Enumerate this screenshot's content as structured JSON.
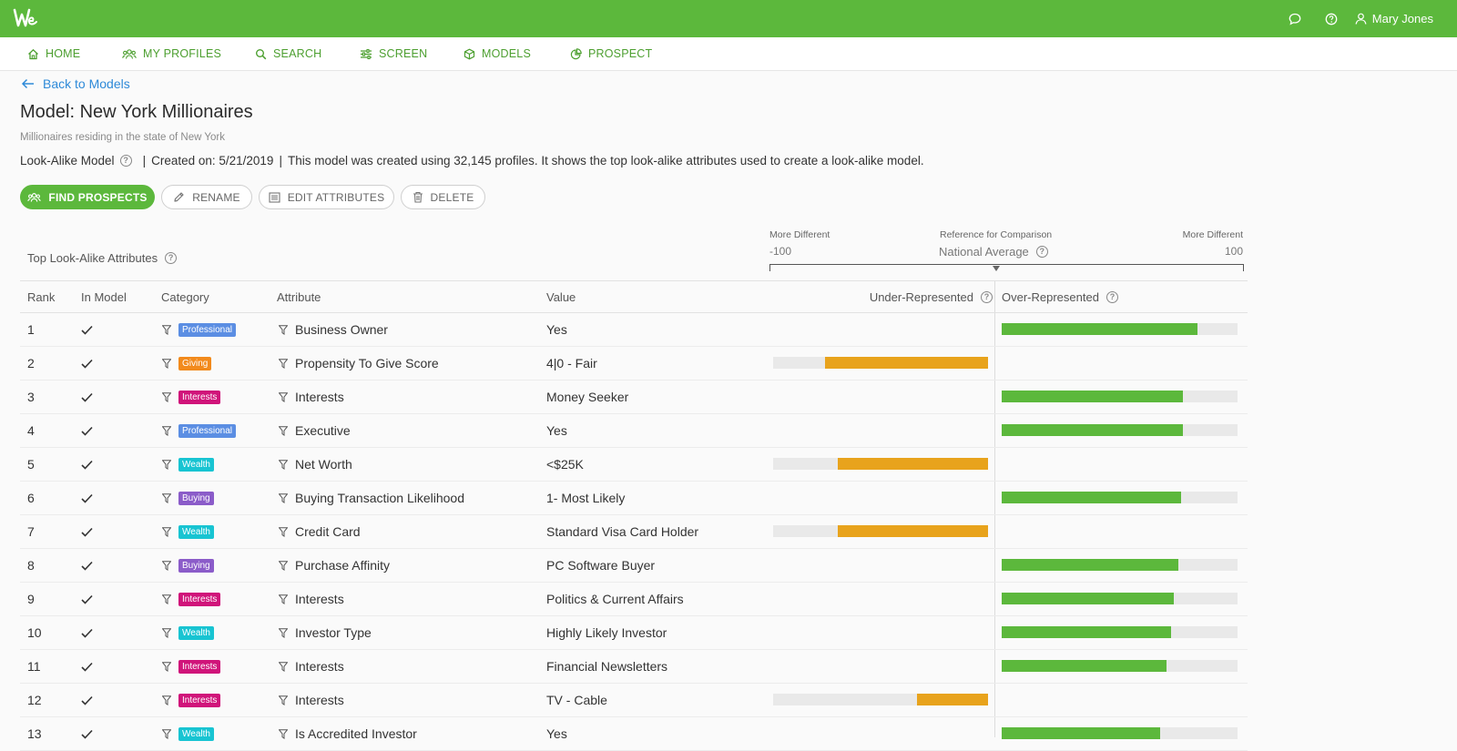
{
  "colors": {
    "brand": "#5cb83c",
    "link": "#2e8ad8",
    "over": "#5cb83c",
    "under": "#e8a31c",
    "badges": {
      "Professional": "#5b8ee3",
      "Giving": "#f28a1c",
      "Interests": "#d0147a",
      "Wealth": "#18c4d2",
      "Buying": "#8b5cc9"
    }
  },
  "header": {
    "logo_icon": "we-logo-icon",
    "chat_icon": "chat-bubble-icon",
    "help_icon": "help-circle-icon",
    "user_icon": "user-icon",
    "user_name": "Mary Jones"
  },
  "nav": {
    "items": [
      {
        "label": "HOME",
        "icon": "home-icon"
      },
      {
        "label": "MY PROFILES",
        "icon": "people-icon"
      },
      {
        "label": "SEARCH",
        "icon": "search-icon"
      },
      {
        "label": "SCREEN",
        "icon": "sliders-icon"
      },
      {
        "label": "MODELS",
        "icon": "cube-icon"
      },
      {
        "label": "PROSPECT",
        "icon": "pie-chart-icon"
      }
    ]
  },
  "page": {
    "back_label": "Back to Models",
    "title": "Model: New York Millionaires",
    "subtitle": "Millionaires residing in the state of New York",
    "model_type": "Look-Alike Model",
    "separator": "|",
    "created": "Created on: 5/21/2019",
    "description": "This model was created using 32,145 profiles. It shows the top look-alike attributes used to create a look-alike model."
  },
  "actions": {
    "find_prospects": "FIND PROSPECTS",
    "rename": "RENAME",
    "edit_attributes": "EDIT ATTRIBUTES",
    "delete": "DELETE"
  },
  "scale": {
    "left_caption": "More Different",
    "left_value": "-100",
    "center_caption": "Reference for Comparison",
    "center_value": "National Average",
    "right_caption": "More Different",
    "right_value": "100"
  },
  "table": {
    "section_label": "Top Look-Alike Attributes",
    "headers": {
      "rank": "Rank",
      "in_model": "In Model",
      "category": "Category",
      "attribute": "Attribute",
      "value": "Value",
      "under": "Under-Represented",
      "over": "Over-Represented"
    },
    "rows": [
      {
        "rank": "1",
        "category": "Professional",
        "attribute": "Business Owner",
        "value": "Yes",
        "direction": "over",
        "score": 83
      },
      {
        "rank": "2",
        "category": "Giving",
        "attribute": "Propensity To Give Score",
        "value": "4|0 - Fair",
        "direction": "under",
        "score": 76
      },
      {
        "rank": "3",
        "category": "Interests",
        "attribute": "Interests",
        "value": "Money Seeker",
        "direction": "over",
        "score": 77
      },
      {
        "rank": "4",
        "category": "Professional",
        "attribute": "Executive",
        "value": "Yes",
        "direction": "over",
        "score": 77
      },
      {
        "rank": "5",
        "category": "Wealth",
        "attribute": "Net Worth",
        "value": "<$25K",
        "direction": "under",
        "score": 70
      },
      {
        "rank": "6",
        "category": "Buying",
        "attribute": "Buying Transaction Likelihood",
        "value": "1- Most Likely",
        "direction": "over",
        "score": 76
      },
      {
        "rank": "7",
        "category": "Wealth",
        "attribute": "Credit Card",
        "value": "Standard Visa Card Holder",
        "direction": "under",
        "score": 70
      },
      {
        "rank": "8",
        "category": "Buying",
        "attribute": "Purchase Affinity",
        "value": "PC Software Buyer",
        "direction": "over",
        "score": 75
      },
      {
        "rank": "9",
        "category": "Interests",
        "attribute": "Interests",
        "value": "Politics & Current Affairs",
        "direction": "over",
        "score": 73
      },
      {
        "rank": "10",
        "category": "Wealth",
        "attribute": "Investor Type",
        "value": "Highly Likely Investor",
        "direction": "over",
        "score": 72
      },
      {
        "rank": "11",
        "category": "Interests",
        "attribute": "Interests",
        "value": "Financial Newsletters",
        "direction": "over",
        "score": 70
      },
      {
        "rank": "12",
        "category": "Interests",
        "attribute": "Interests",
        "value": "TV - Cable",
        "direction": "under",
        "score": 33
      },
      {
        "rank": "13",
        "category": "Wealth",
        "attribute": "Is Accredited Investor",
        "value": "Yes",
        "direction": "over",
        "score": 67
      }
    ]
  }
}
